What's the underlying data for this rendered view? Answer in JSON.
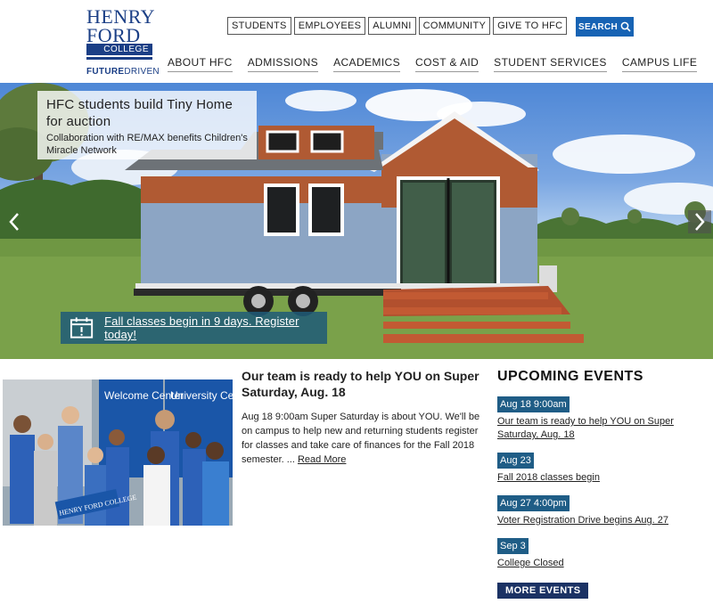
{
  "logo": {
    "line1": "HENRY",
    "line2": "FORD",
    "line3": "COLLEGE",
    "tagline_bold": "FUTURE",
    "tagline_rest": "DRIVEN"
  },
  "audience_nav": [
    "STUDENTS",
    "EMPLOYEES",
    "ALUMNI",
    "COMMUNITY",
    "GIVE TO HFC"
  ],
  "search": {
    "label": "SEARCH",
    "icon": "search-icon"
  },
  "main_nav": [
    "ABOUT HFC",
    "ADMISSIONS",
    "ACADEMICS",
    "COST & AID",
    "STUDENT SERVICES",
    "CAMPUS LIFE"
  ],
  "hero": {
    "title": "HFC students build Tiny Home for auction",
    "subtitle": "Collaboration with RE/MAX benefits Children's Miracle Network",
    "alert": "Fall classes begin in 9 days. Register today!",
    "alert_icon": "calendar-alert-icon",
    "prev_icon": "chevron-left-icon",
    "next_icon": "chevron-right-icon"
  },
  "story": {
    "title": "Our team is ready to help YOU on Super Saturday, Aug. 18",
    "body": "Aug 18 9:00am Super Saturday is about YOU. We'll be on campus to help new and returning students register for classes and take care of finances for the Fall 2018 semester. ...",
    "read_more": "Read More",
    "photo_signs": [
      "Welcome Center",
      "University Center"
    ],
    "photo_banner": "HENRY FORD COLLEGE"
  },
  "events": {
    "heading": "UPCOMING EVENTS",
    "items": [
      {
        "date": "Aug 18 9:00am",
        "title": "Our team is ready to help YOU on Super Saturday, Aug. 18"
      },
      {
        "date": "Aug 23",
        "title": "Fall 2018 classes begin"
      },
      {
        "date": "Aug 27 4:00pm",
        "title": "Voter Registration Drive begins Aug. 27"
      },
      {
        "date": "Sep 3",
        "title": "College Closed"
      }
    ],
    "more_label": "MORE EVENTS"
  },
  "colors": {
    "brand_blue": "#1b3f86",
    "search_blue": "#1763b4",
    "event_date_bg": "#1f5d86",
    "more_events_bg": "#1b3264"
  }
}
